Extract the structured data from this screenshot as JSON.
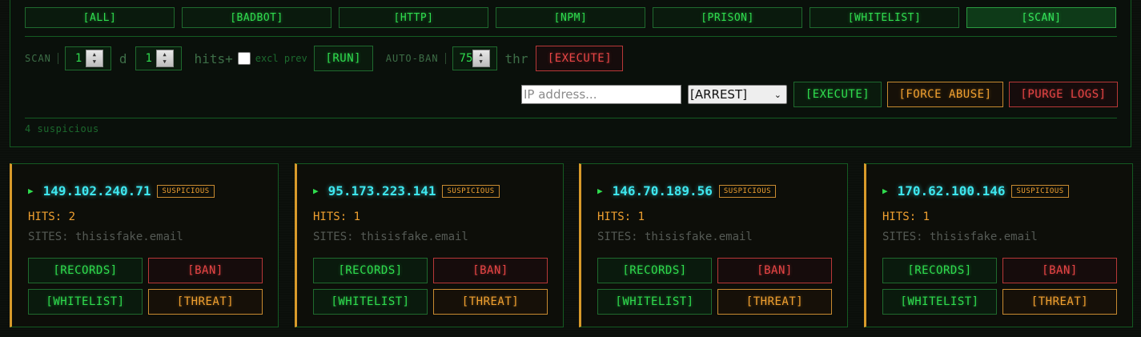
{
  "tabs": [
    "[ALL]",
    "[BADBOT]",
    "[HTTP]",
    "[NPM]",
    "[PRISON]",
    "[WHITELIST]",
    "[SCAN]"
  ],
  "active_tab": "[SCAN]",
  "scan": {
    "label": "SCAN",
    "days_value": "1",
    "days_unit": "d",
    "hits_value": "1",
    "hits_unit": "hits+",
    "excl_label": "excl prev",
    "run_label": "[RUN]",
    "autoban_label": "AUTO-BAN",
    "thr_value": "75",
    "thr_unit": "thr",
    "execute_label": "[EXECUTE]"
  },
  "actions": {
    "ip_placeholder": "IP address...",
    "select_value": "[ARREST]",
    "execute_label": "[EXECUTE]",
    "force_label": "[FORCE ABUSE]",
    "purge_label": "[PURGE LOGS]"
  },
  "count_text": "4 suspicious",
  "cards": [
    {
      "ip": "149.102.240.71",
      "badge": "SUSPICIOUS",
      "hits": "HITS: 2",
      "sites": "SITES: thisisfake.email"
    },
    {
      "ip": "95.173.223.141",
      "badge": "SUSPICIOUS",
      "hits": "HITS: 1",
      "sites": "SITES: thisisfake.email"
    },
    {
      "ip": "146.70.189.56",
      "badge": "SUSPICIOUS",
      "hits": "HITS: 1",
      "sites": "SITES: thisisfake.email"
    },
    {
      "ip": "170.62.100.146",
      "badge": "SUSPICIOUS",
      "hits": "HITS: 1",
      "sites": "SITES: thisisfake.email"
    }
  ],
  "card_buttons": {
    "records": "[RECORDS]",
    "ban": "[BAN]",
    "whitelist": "[WHITELIST]",
    "threat": "[THREAT]"
  },
  "icons": {
    "expand": "triangle-right-icon"
  },
  "colors": {
    "green": "#2fdc4e",
    "cyan": "#3ee6ee",
    "orange": "#f0a030",
    "red": "#e84545"
  }
}
